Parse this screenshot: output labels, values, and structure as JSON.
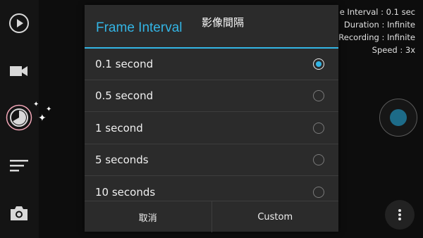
{
  "background_info": {
    "lines": [
      "e Interval : 0.1 sec",
      "Duration : Infinite",
      "Recording : Infinite",
      "Speed : 3x"
    ]
  },
  "left_toolbar": {
    "icons": [
      "play-icon",
      "video-camera-icon",
      "timer-icon",
      "list-icon",
      "camera-icon"
    ]
  },
  "dialog": {
    "title": "Frame Interval",
    "title_cn": "影像間隔",
    "options": [
      {
        "label": "0.1 second",
        "checked": true
      },
      {
        "label": "0.5 second",
        "checked": false
      },
      {
        "label": "1 second",
        "checked": false
      },
      {
        "label": "5 seconds",
        "checked": false
      },
      {
        "label": "10 seconds",
        "checked": false
      }
    ],
    "cancel_label": "取消",
    "custom_label": "Custom"
  },
  "colors": {
    "accent": "#33b5e5",
    "shutter": "#1d6b88",
    "dialog_bg": "#2b2b2b",
    "app_bg": "#0d0d0d"
  }
}
